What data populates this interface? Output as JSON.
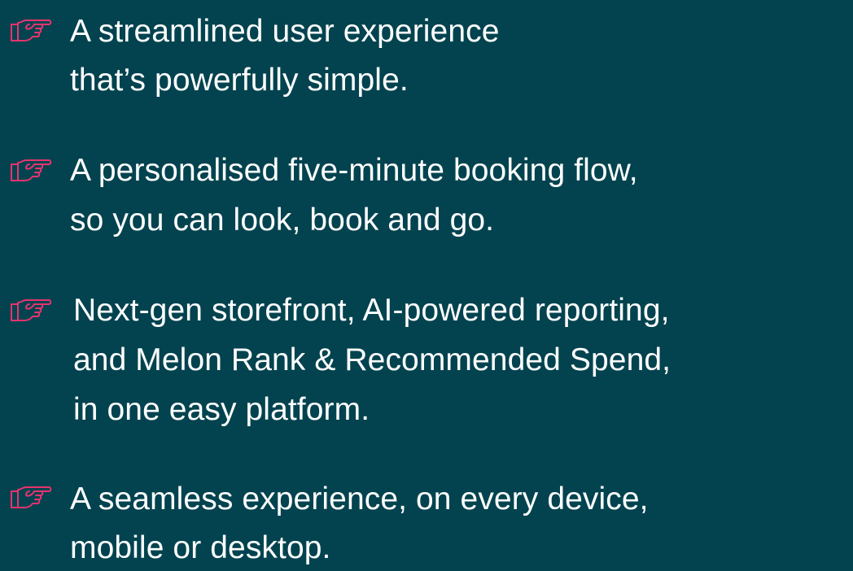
{
  "accent_color": "#e8336f",
  "background_color": "#02434f",
  "icon": "pointing-hand-icon",
  "items": [
    {
      "lines": [
        "A streamlined user experience",
        "that’s powerfully simple."
      ]
    },
    {
      "lines": [
        "A personalised five-minute booking flow,",
        "so you can look, book and go."
      ]
    },
    {
      "lines": [
        "Next-gen storefront, AI-powered reporting,",
        "and Melon Rank & Recommended Spend,",
        "in one easy platform."
      ]
    },
    {
      "lines": [
        "A seamless experience, on every device,",
        "mobile or desktop."
      ]
    }
  ]
}
